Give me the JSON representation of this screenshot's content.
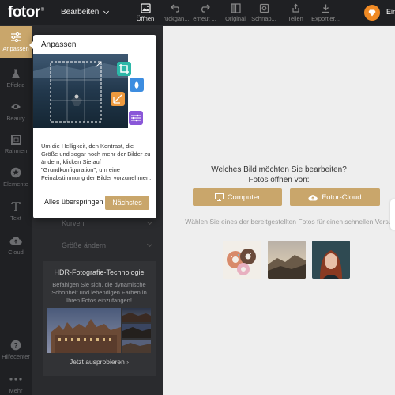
{
  "app": {
    "logo": "fotor",
    "logo_mark": "®",
    "edit_menu": "Bearbeiten",
    "login": "Ein"
  },
  "toolbar": {
    "items": [
      {
        "label": "Öffnen",
        "icon": "image-icon",
        "active": true
      },
      {
        "label": "rückgän...",
        "icon": "undo-icon"
      },
      {
        "label": "erneut ...",
        "icon": "redo-icon"
      },
      {
        "label": "Original",
        "icon": "compare-icon"
      },
      {
        "label": "Schnap...",
        "icon": "snapshot-icon"
      },
      {
        "label": "Teilen",
        "icon": "share-icon"
      },
      {
        "label": "Exportier...",
        "icon": "download-icon"
      }
    ]
  },
  "rail": {
    "items": [
      {
        "label": "Anpassen",
        "icon": "sliders-icon",
        "active": true
      },
      {
        "label": "Effekte",
        "icon": "flask-icon"
      },
      {
        "label": "Beauty",
        "icon": "eye-icon"
      },
      {
        "label": "Rahmen",
        "icon": "frame-icon"
      },
      {
        "label": "Elemente",
        "icon": "star-icon"
      },
      {
        "label": "Text",
        "icon": "text-icon"
      },
      {
        "label": "Cloud",
        "icon": "cloud-icon"
      },
      {
        "label": "Hilfecenter",
        "icon": "help-icon"
      },
      {
        "label": "Mehr",
        "icon": "more-icon"
      }
    ]
  },
  "panel": {
    "rows": [
      {
        "label": "Kurven"
      },
      {
        "label": "Größe ändern"
      }
    ],
    "hdr": {
      "title": "HDR-Fotografie-Technologie",
      "desc": "Befähigen Sie sich, die dynamische Schönheit und lebendigen Farben in Ihren Fotos einzufangen!",
      "link": "Jetzt ausprobieren ›"
    }
  },
  "popup": {
    "title": "Anpassen",
    "desc": "Um die Helligkeit, den Kontrast, die Größe und sogar noch mehr der Bilder zu ändern, klicken Sie auf \"Grundkonfiguration\", um eine Feinabstimmung der Bilder vorzunehmen.",
    "skip": "Alles überspringen",
    "next": "Nächstes"
  },
  "main": {
    "question_1": "Welches Bild möchten Sie bearbeiten?",
    "question_2": "Fotos öffnen von:",
    "computer": "Computer",
    "cloud": "Fotor-Cloud",
    "hint": "Wählen Sie eines der bereitgestellten Fotos für einen schnellen Versuch."
  },
  "colors": {
    "accent": "#c9a66b",
    "premium": "#f08a24",
    "sidebar": "#1f2023",
    "panel": "#2a2b2e",
    "canvas": "#eeeeee"
  }
}
